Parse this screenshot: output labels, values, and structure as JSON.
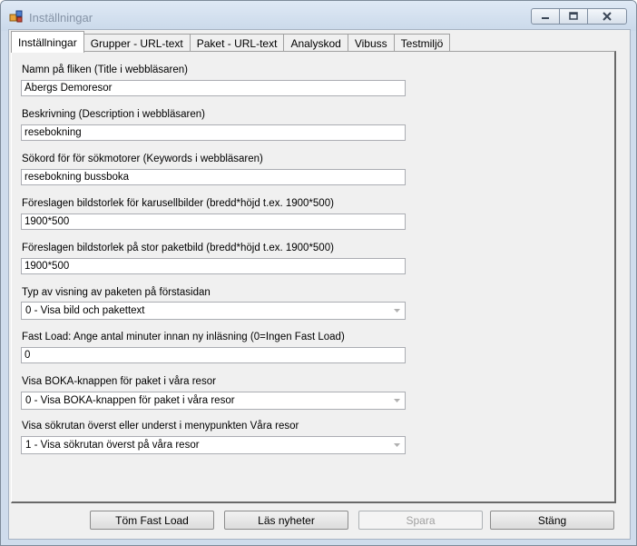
{
  "window": {
    "title": "Inställningar"
  },
  "tabs": [
    {
      "label": "Inställningar",
      "active": true
    },
    {
      "label": "Grupper - URL-text"
    },
    {
      "label": "Paket - URL-text"
    },
    {
      "label": "Analyskod"
    },
    {
      "label": "Vibuss"
    },
    {
      "label": "Testmiljö"
    }
  ],
  "fields": {
    "tab_title": {
      "label": "Namn på fliken (Title i webbläsaren)",
      "value": "Åbergs Demoresor"
    },
    "description": {
      "label": "Beskrivning (Description i webbläsaren)",
      "value": "resebokning"
    },
    "keywords": {
      "label": "Sökord för för sökmotorer (Keywords i webbläsaren)",
      "value": "resebokning bussboka"
    },
    "carousel_size": {
      "label": "Föreslagen bildstorlek för karusellbilder (bredd*höjd t.ex. 1900*500)",
      "value": "1900*500"
    },
    "package_image_size": {
      "label": "Föreslagen bildstorlek på stor paketbild (bredd*höjd t.ex. 1900*500)",
      "value": "1900*500"
    },
    "display_type": {
      "label": "Typ av visning av paketen på förstasidan",
      "value": "0 - Visa bild och pakettext"
    },
    "fast_load": {
      "label": "Fast Load: Ange antal minuter innan ny inläsning (0=Ingen Fast Load)",
      "value": "0"
    },
    "boka_button": {
      "label": "Visa BOKA-knappen för paket i våra resor",
      "value": "0 - Visa BOKA-knappen för paket i våra resor"
    },
    "search_position": {
      "label": "Visa sökrutan överst eller underst i menypunkten Våra resor",
      "value": "1 - Visa sökrutan överst på våra resor"
    }
  },
  "buttons": {
    "clear_fast_load": "Töm Fast Load",
    "read_news": "Läs nyheter",
    "save": "Spara",
    "close": "Stäng"
  }
}
